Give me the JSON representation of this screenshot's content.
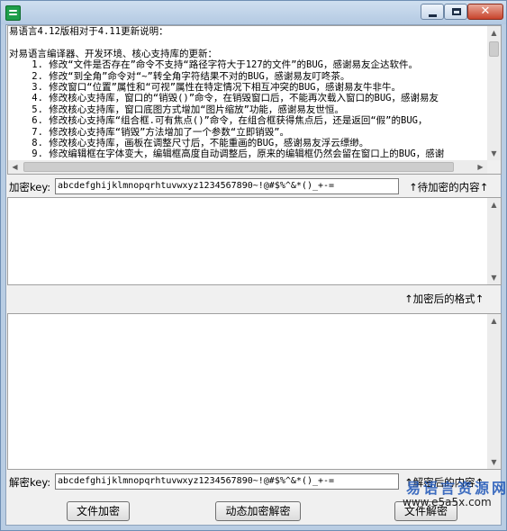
{
  "window": {
    "icon": "app-icon",
    "min_label": "minimize-icon",
    "max_label": "maximize-icon",
    "close_glyph": "✕"
  },
  "notes": {
    "lines": [
      "易语言4.12版相对于4.11更新说明：",
      "",
      "对易语言编译器、开发环境、核心支持库的更新：",
      "    1. 修改“文件是否存在”命令不支持“路径字符大于127的文件”的BUG，感谢易友企达软件。",
      "    2. 修改“到全角”命令对“~”转全角字符结果不对的BUG，感谢易友叮咚茶。",
      "    3. 修改窗口“位置”属性和“可视”属性在特定情况下相互冲突的BUG，感谢易友牛非牛。",
      "    4. 修改核心支持库，窗口的“销毁()”命令，在销毁窗口后，不能再次载入窗口的BUG，感谢易友",
      "    5. 修改核心支持库，窗口底图方式增加“图片缩放”功能，感谢易友世恒。",
      "    6. 修改核心支持库“组合框.可有焦点()”命令，在组合框获得焦点后，还是返回“假”的BUG，",
      "    7. 修改核心支持库“销毁”方法增加了一个参数“立即销毁”。",
      "    8. 修改核心支持库，画板在调整尺寸后，不能重画的BUG，感谢易友浮云缥缈。",
      "    9. 修改编辑框在字体变大，编辑框高度自动调整后，原来的编辑框仍然会留在窗口上的BUG，感谢"
    ]
  },
  "encrypt": {
    "key_label": "加密key:",
    "key_value": "abcdefghijklmnopqrhtuvwxyz1234567890~!@#$%^&*()_+-=",
    "input_label": "↑待加密的内容↑",
    "output_label": "↑加密后的格式↑"
  },
  "decrypt": {
    "key_label": "解密key:",
    "key_value": "abcdefghijklmnopqrhtuvwxyz1234567890~!@#$%^&*()_+-=",
    "output_label": "↑解密后的内容↑"
  },
  "buttons": {
    "file_encrypt": "文件加密",
    "dynamic_decrypt": "动态加密解密",
    "file_decrypt": "文件解密"
  },
  "watermark": {
    "cn": "易语言资源网",
    "url": "www.e5a5x.com"
  }
}
